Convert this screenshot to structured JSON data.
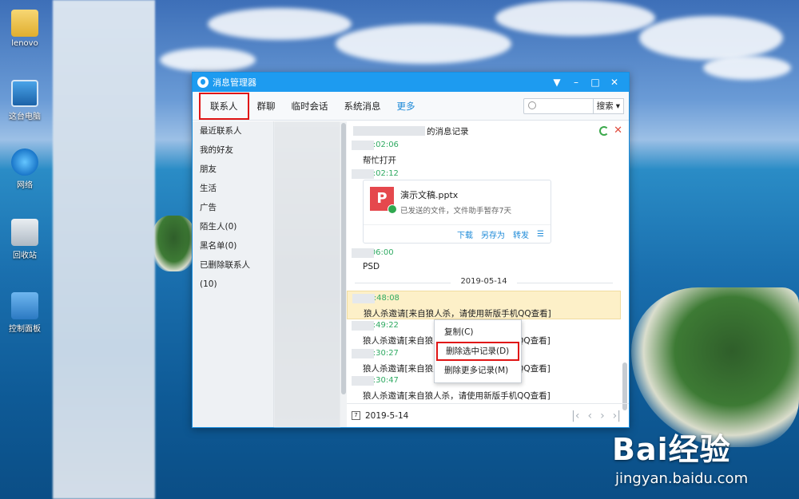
{
  "desktop": {
    "icons": [
      {
        "label": "lenovo"
      },
      {
        "label": "这台电脑"
      },
      {
        "label": "网络"
      },
      {
        "label": "回收站"
      },
      {
        "label": "控制面板"
      }
    ]
  },
  "watermark": {
    "logo": "Bai经验",
    "url": "jingyan.baidu.com"
  },
  "window": {
    "title": "消息管理器",
    "controls": {
      "menu": "▼",
      "minimize": "–",
      "maximize": "□",
      "close": "✕"
    }
  },
  "tabs": [
    {
      "label": "联系人"
    },
    {
      "label": "群聊"
    },
    {
      "label": "临时会话"
    },
    {
      "label": "系统消息"
    },
    {
      "label": "更多"
    }
  ],
  "search": {
    "placeholder": "",
    "button": "搜索"
  },
  "sidebar": {
    "items": [
      {
        "label": "最近联系人"
      },
      {
        "label": "我的好友"
      },
      {
        "label": "朋友"
      },
      {
        "label": "生活"
      },
      {
        "label": "广告"
      },
      {
        "label": "陌生人(0)"
      },
      {
        "label": "黑名单(0)"
      },
      {
        "label": "已删除联系人(10)"
      }
    ]
  },
  "chat": {
    "header_suffix": "的消息记录",
    "messages": [
      {
        "time": "22:02:06",
        "text": "帮忙打开"
      },
      {
        "time": "22:02:12",
        "text": ""
      },
      {
        "time": "2:06:00",
        "text": "PSD"
      },
      {
        "time": "16:48:08",
        "text": "狼人杀邀请[来自狼人杀，请使用新版手机QQ查看]"
      },
      {
        "time": "16:49:22",
        "text": "狼人杀邀请[来自狼人杀，请使用新版手机QQ查看]"
      },
      {
        "time": "18:30:27",
        "text": "狼人杀邀请[来自狼人杀，请使用新版手机QQ查看]"
      },
      {
        "time": "18:30:47",
        "text": "狼人杀邀请[来自狼人杀，请使用新版手机QQ查看]"
      }
    ],
    "file": {
      "name": "演示文稿.pptx",
      "status": "已发送的文件，文件助手暂存7天",
      "actions": [
        "下载",
        "另存为",
        "转发"
      ]
    },
    "date_separator": "2019-05-14",
    "footer_date": "2019-5-14"
  },
  "context_menu": {
    "items": [
      {
        "label": "复制(C)"
      },
      {
        "label": "删除选中记录(D)"
      },
      {
        "label": "删除更多记录(M)"
      }
    ]
  }
}
